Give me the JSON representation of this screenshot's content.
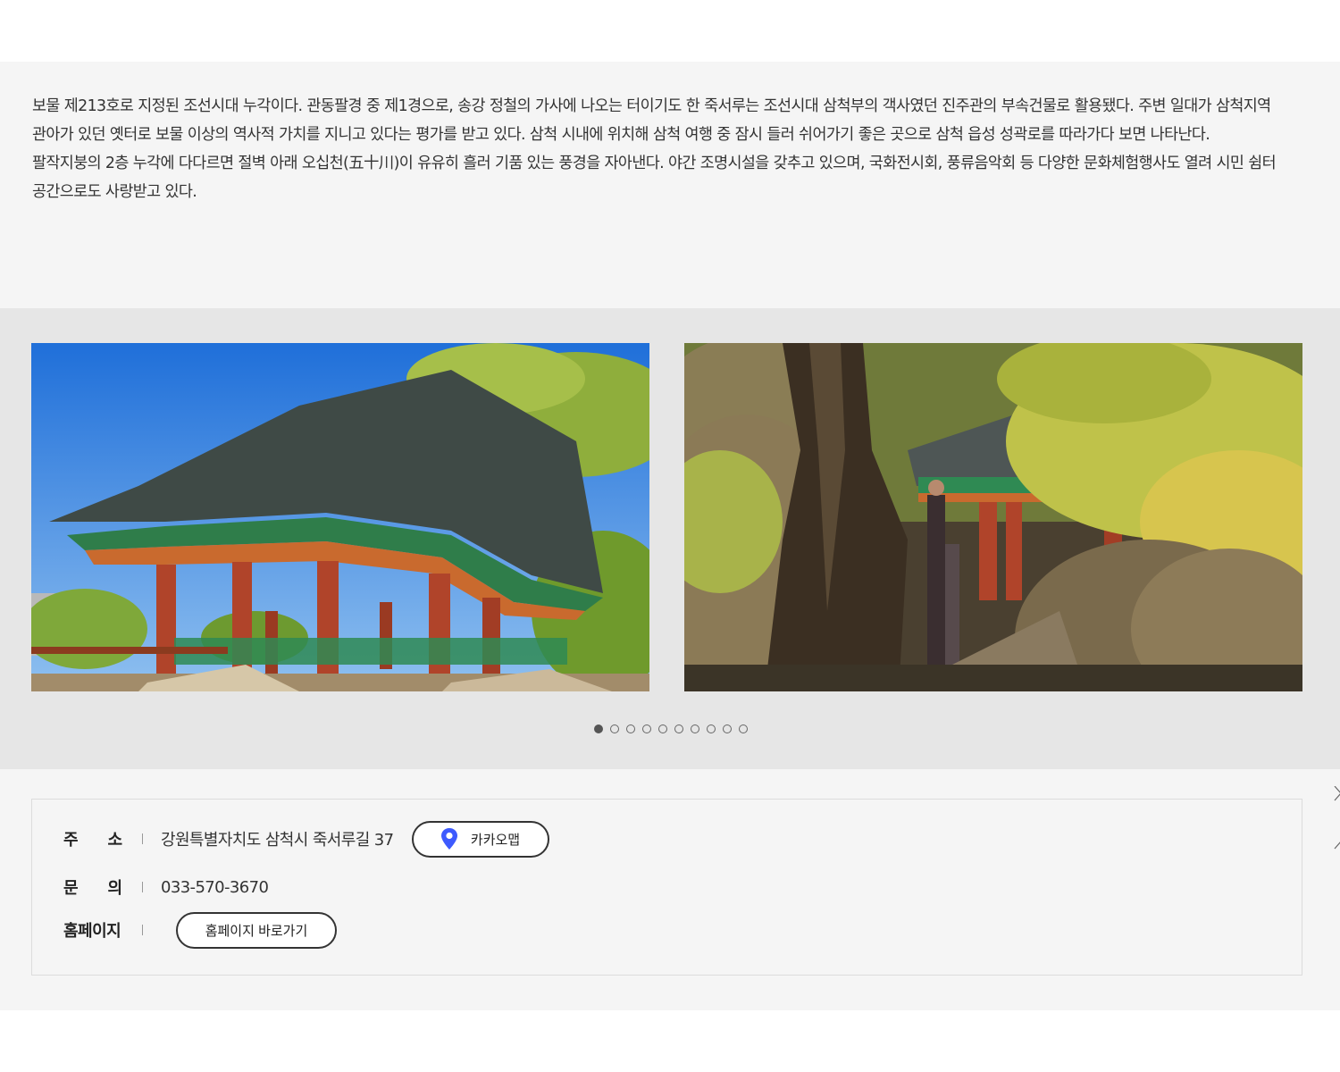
{
  "description": {
    "lines": [
      "보물 제213호로 지정된 조선시대 누각이다. 관동팔경 중 제1경으로, 송강 정철의 가사에 나오는 터이기도 한 죽서루는 조선시대 삼척부의 객사였던 진주관의 부속건물로 활용됐다. 주변 일대가 삼척지역",
      "관아가 있던 옛터로 보물 이상의 역사적 가치를 지니고 있다는 평가를 받고 있다. 삼척 시내에 위치해 삼척 여행 중 잠시 들러 쉬어가기 좋은 곳으로 삼척 읍성 성곽로를 따라가다 보면 나타난다.",
      "팔작지붕의 2층 누각에 다다르면 절벽 아래 오십천(五十川)이 유유히 흘러 기품 있는 풍경을 자아낸다. 야간 조명시설을 갖추고 있으며, 국화전시회, 풍류음악회 등 다양한 문화체험행사도 열려 시민 쉼터",
      "공간으로도 사랑받고 있다."
    ]
  },
  "gallery": {
    "slides": [
      {
        "alt": "죽서루 누각 전경",
        "icon": "photo-pavilion"
      },
      {
        "alt": "죽서루 바위와 단풍",
        "icon": "photo-rocks-autumn"
      }
    ],
    "dot_count": 10,
    "active_dot": 0,
    "next_icon": "chevron-right-icon"
  },
  "info": {
    "address": {
      "label_chars": [
        "주",
        "소"
      ],
      "value": "강원특별자치도 삼척시 죽서루길 37",
      "map_button": "카카오맵",
      "map_icon": "location-pin-icon"
    },
    "phone": {
      "label_chars": [
        "문",
        "의"
      ],
      "value": "033-570-3670"
    },
    "homepage": {
      "label": "홈페이지",
      "button": "홈페이지 바로가기"
    }
  },
  "colors": {
    "section_bg": "#f5f5f5",
    "gallery_bg": "#e6e6e6",
    "pin_blue": "#3d5afe",
    "pillar_red": "#b0442a"
  }
}
